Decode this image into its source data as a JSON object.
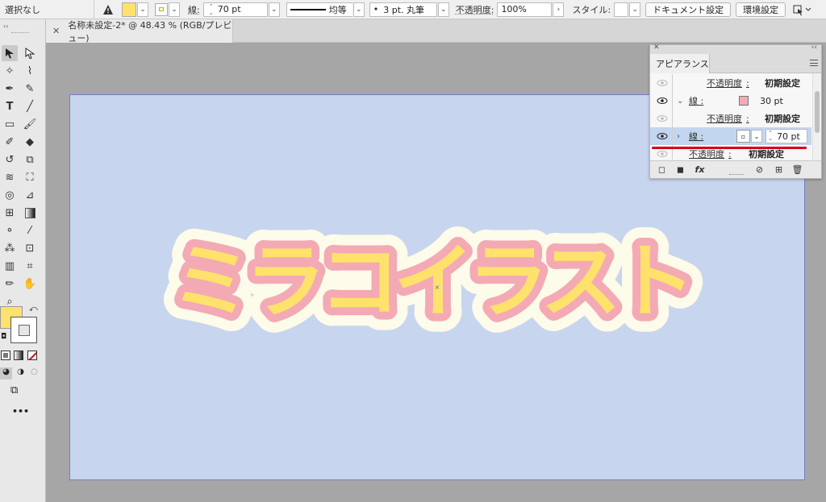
{
  "control_bar": {
    "selection": "選択なし",
    "fill_color": "#ffe26b",
    "stroke_label": "線",
    "stroke_weight": "70 pt",
    "profile_label": "均等",
    "brush_label": "3 pt. 丸筆",
    "opacity_label": "不透明度",
    "opacity_value": "100%",
    "style_label": "スタイル",
    "doc_settings_button": "ドキュメント設定",
    "preferences_button": "環境設定"
  },
  "document_tab": {
    "title": "名称未設定-2* @ 48.43 % (RGB/プレビュー)"
  },
  "tools_panel": {
    "fill_color": "#ffe26b",
    "stroke_color": "#f7f7f7",
    "more_label": "•••"
  },
  "artwork": {
    "text": "ミラコイラスト",
    "fill_color": "#ffe26b",
    "inner_stroke_color": "#f3aab5",
    "outer_stroke_color": "#fdfbe9",
    "artboard_color": "#c8d5ee"
  },
  "appearance_panel": {
    "tab_label": "アピアランス",
    "rows": [
      {
        "label": "不透明度",
        "value": "初期設定"
      },
      {
        "label": "線",
        "value": "30 pt",
        "swatch_color": "#f3aab5"
      },
      {
        "label": "不透明度",
        "value": "初期設定"
      },
      {
        "label": "線",
        "value": "70 pt"
      },
      {
        "label": "不透明度",
        "value": "初期設定"
      }
    ],
    "colon": ":"
  }
}
